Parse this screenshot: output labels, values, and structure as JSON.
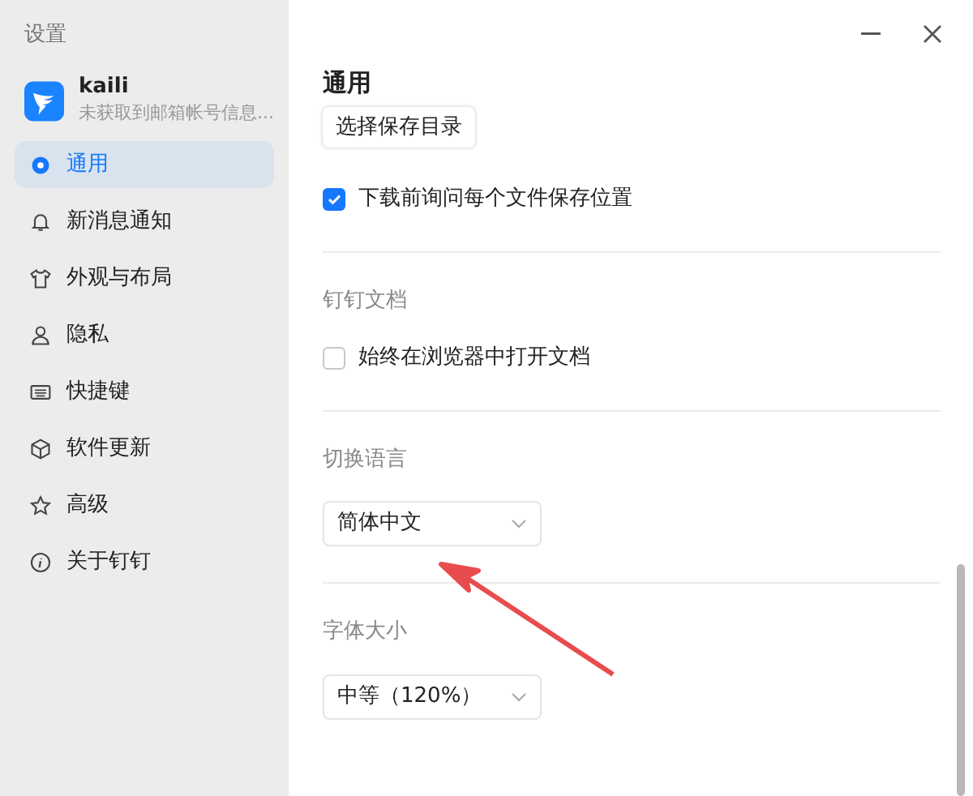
{
  "sidebar": {
    "title": "设置",
    "account": {
      "name": "kaili",
      "subtitle": "未获取到邮箱帐号信息..."
    },
    "items": [
      {
        "label": "通用",
        "selected": true
      },
      {
        "label": "新消息通知",
        "selected": false
      },
      {
        "label": "外观与布局",
        "selected": false
      },
      {
        "label": "隐私",
        "selected": false
      },
      {
        "label": "快捷键",
        "selected": false
      },
      {
        "label": "软件更新",
        "selected": false
      },
      {
        "label": "高级",
        "selected": false
      },
      {
        "label": "关于钉钉",
        "selected": false
      }
    ]
  },
  "main": {
    "heading": "通用",
    "sections": [
      {
        "controls": [
          {
            "kind": "button",
            "label": "选择保存目录"
          },
          {
            "kind": "checkbox",
            "label": "下载前询问每个文件保存位置",
            "checked": true
          }
        ]
      },
      {
        "title": "钉钉文档",
        "controls": [
          {
            "kind": "checkbox",
            "label": "始终在浏览器中打开文档",
            "checked": false
          }
        ]
      },
      {
        "title": "切换语言",
        "controls": [
          {
            "kind": "select",
            "value": "简体中文"
          }
        ]
      },
      {
        "title": "字体大小",
        "controls": [
          {
            "kind": "select",
            "value": "中等（120%）"
          }
        ]
      }
    ]
  }
}
